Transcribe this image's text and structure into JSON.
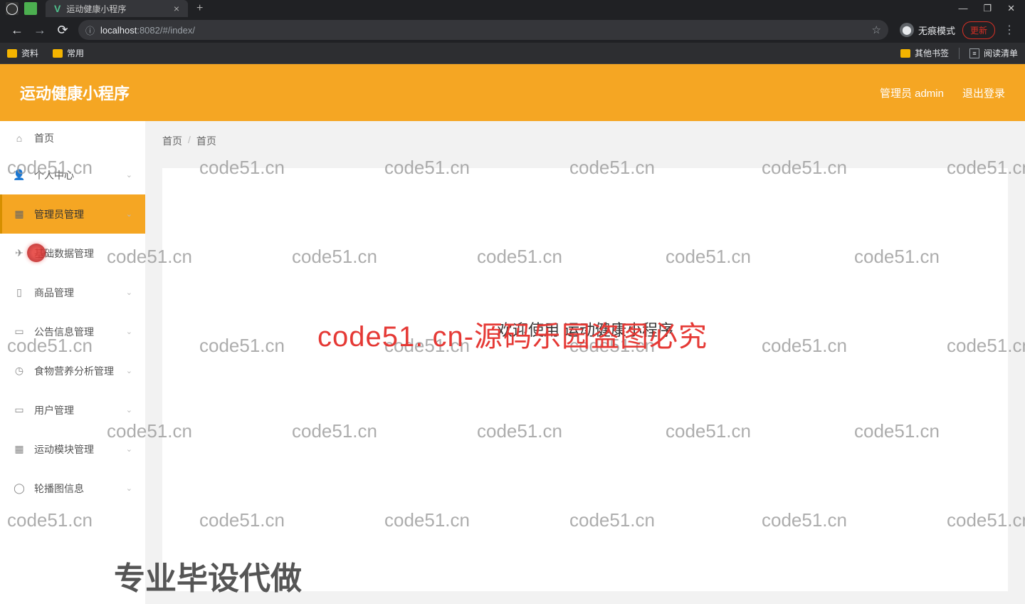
{
  "browser": {
    "tab_title": "运动健康小程序",
    "tab_close": "×",
    "tab_add": "+",
    "win_min": "—",
    "win_max": "❐",
    "win_close": "✕",
    "nav_back": "←",
    "nav_fwd": "→",
    "nav_reload": "⟳",
    "url_info": "ⓘ",
    "url_host": "localhost",
    "url_port_path": ":8082/#/index/",
    "star": "☆",
    "incognito_label": "无痕模式",
    "update_label": "更新",
    "kebab": "⋮",
    "bookmarks": {
      "b1": "资料",
      "b2": "常用",
      "other": "其他书签",
      "reading": "阅读清单"
    }
  },
  "app": {
    "title": "运动健康小程序",
    "header_user": "管理员 admin",
    "header_logout": "退出登录"
  },
  "sidebar": {
    "home": "首页",
    "personal": "个人中心",
    "admin": "管理员管理",
    "basedata": "基础数据管理",
    "goods": "商品管理",
    "notice": "公告信息管理",
    "food": "食物营养分析管理",
    "user": "用户管理",
    "sport": "运动模块管理",
    "carousel": "轮播图信息"
  },
  "breadcrumb": {
    "a": "首页",
    "sep": "/",
    "b": "首页"
  },
  "content": {
    "welcome": "欢迎使用 运动健康小程序"
  },
  "watermark": {
    "text": "code51.cn",
    "center": "code51. cn-源码乐园盗图必究",
    "bottom": "专业毕设代做"
  }
}
